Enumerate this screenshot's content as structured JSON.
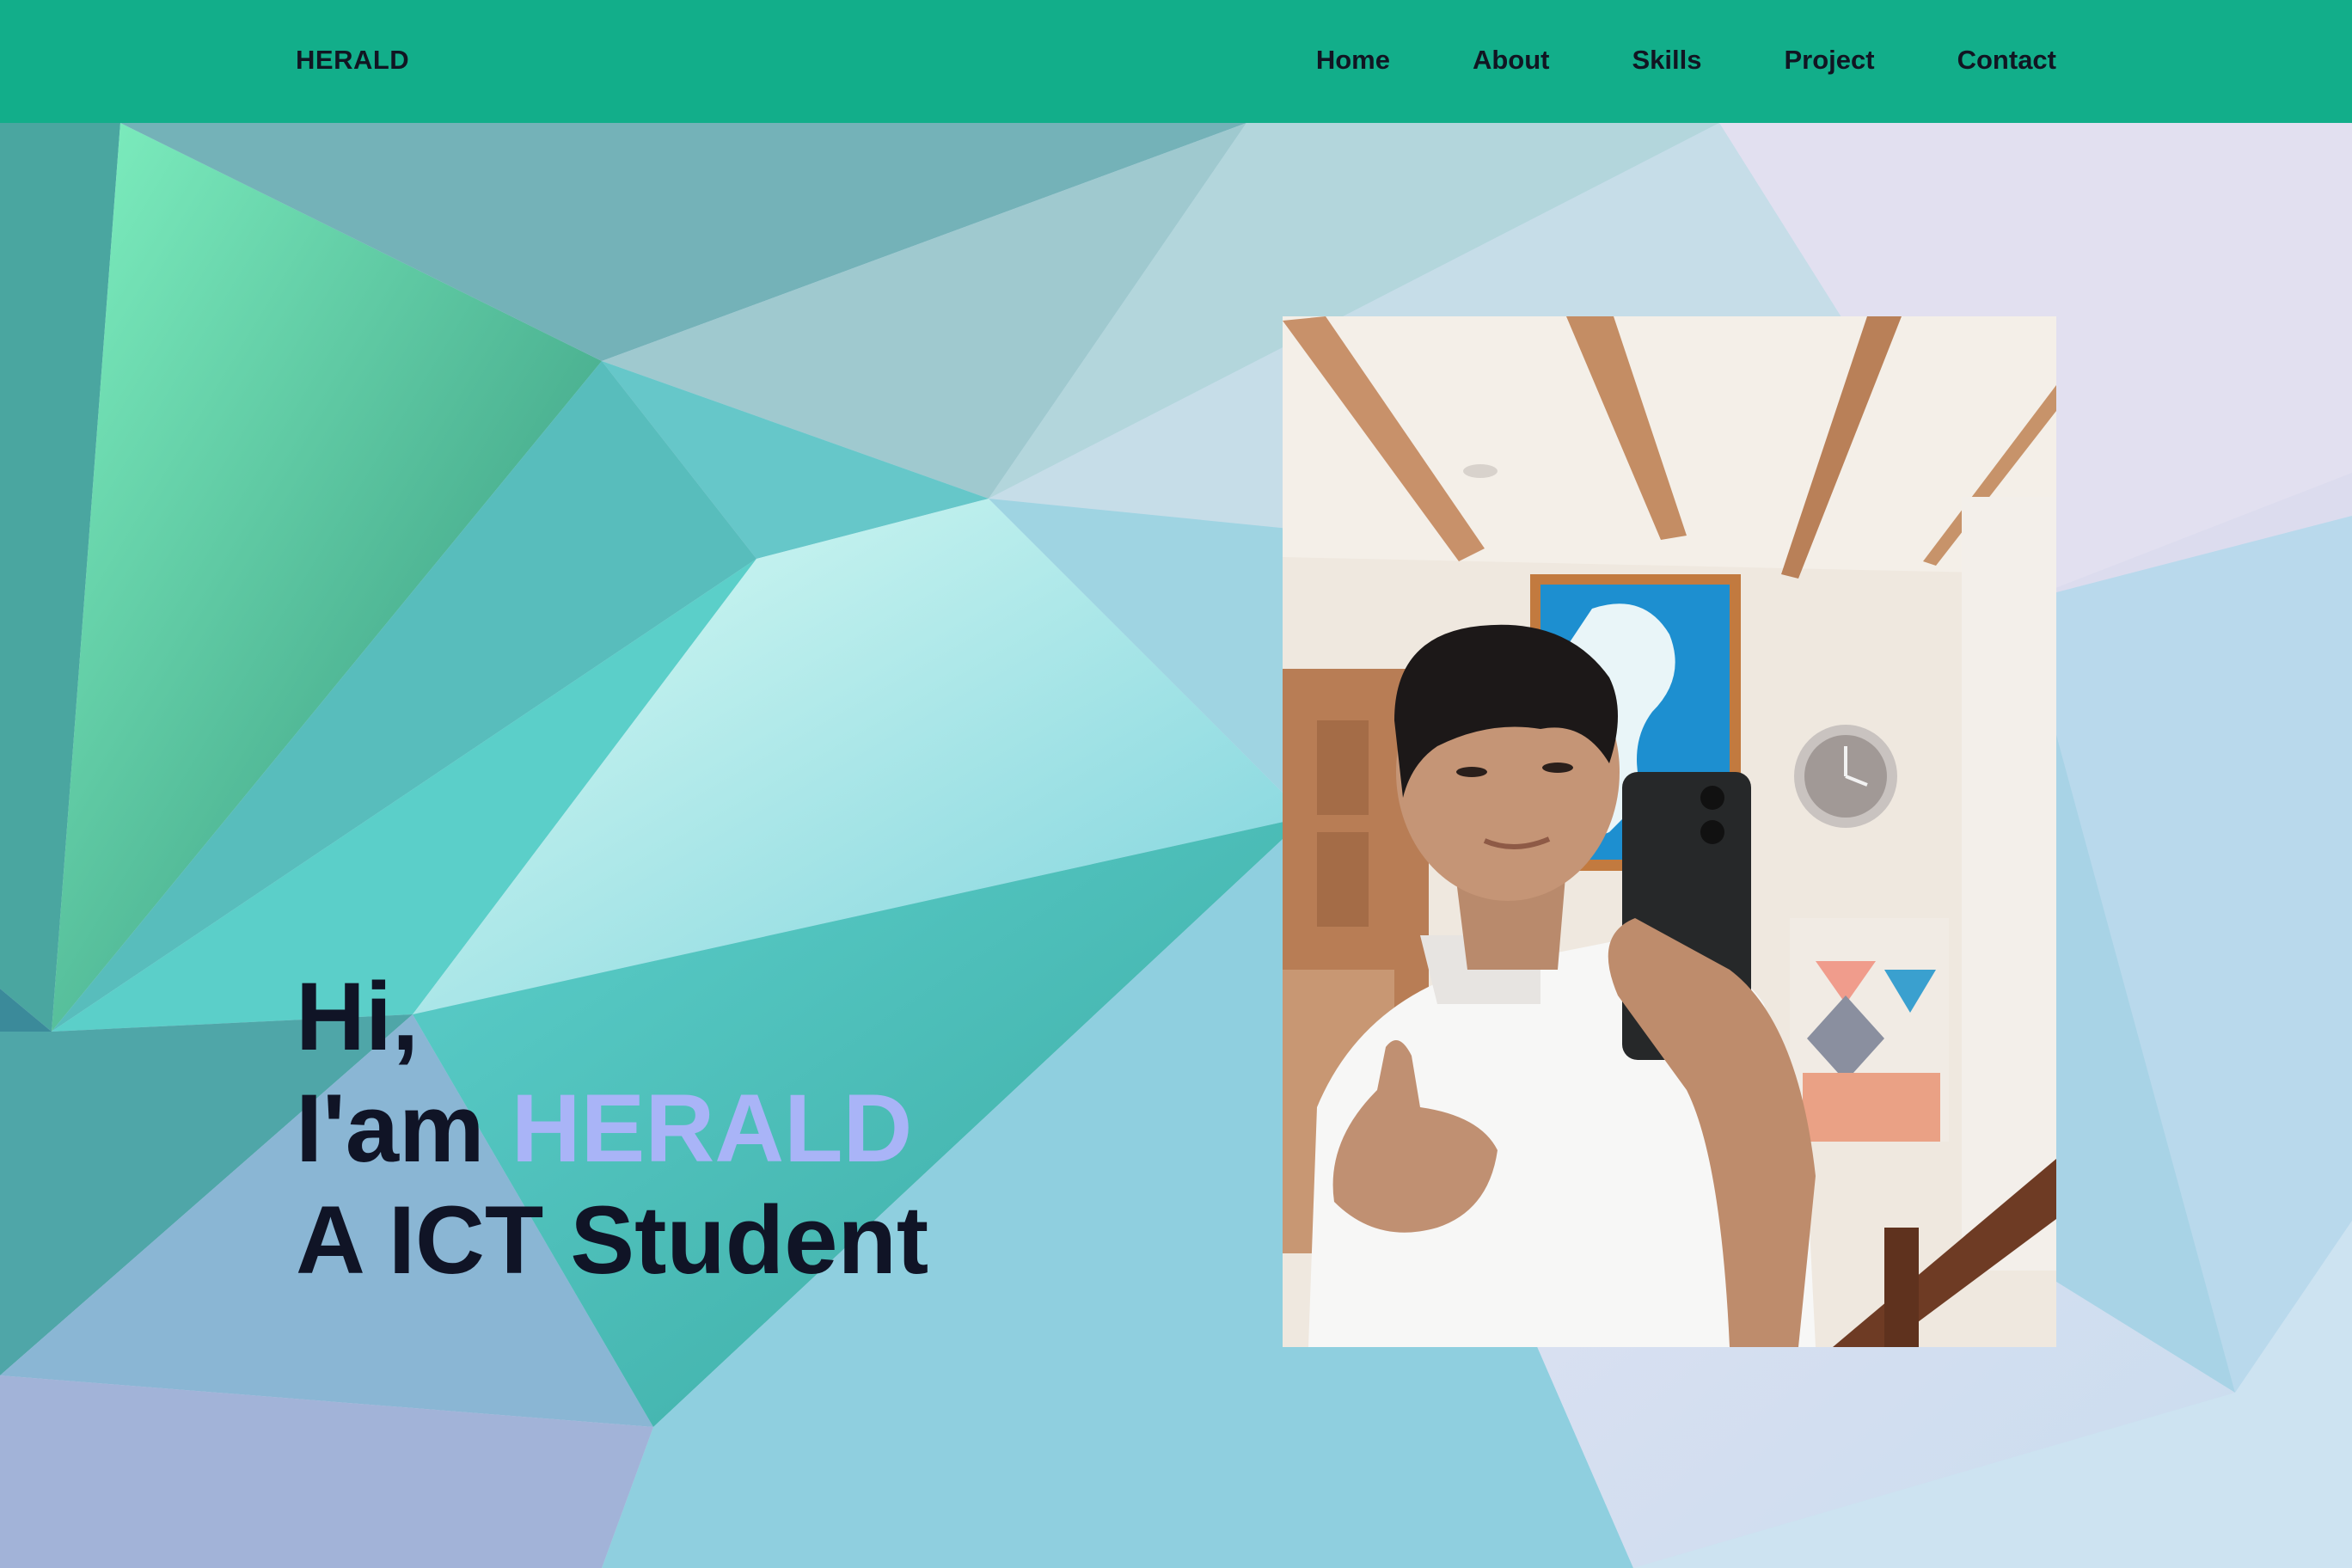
{
  "navbar": {
    "brand": "HERALD",
    "links": [
      "Home",
      "About",
      "Skills",
      "Project",
      "Contact"
    ]
  },
  "hero": {
    "greeting": "Hi,",
    "intro_prefix": "I'am",
    "name": "HERALD",
    "role": "A ICT Student"
  },
  "colors": {
    "navbar": "#12ae8a",
    "name_accent": "#a9b4f7",
    "heading_text": "#101426"
  },
  "photo": {
    "icon": "portrait-photo"
  }
}
